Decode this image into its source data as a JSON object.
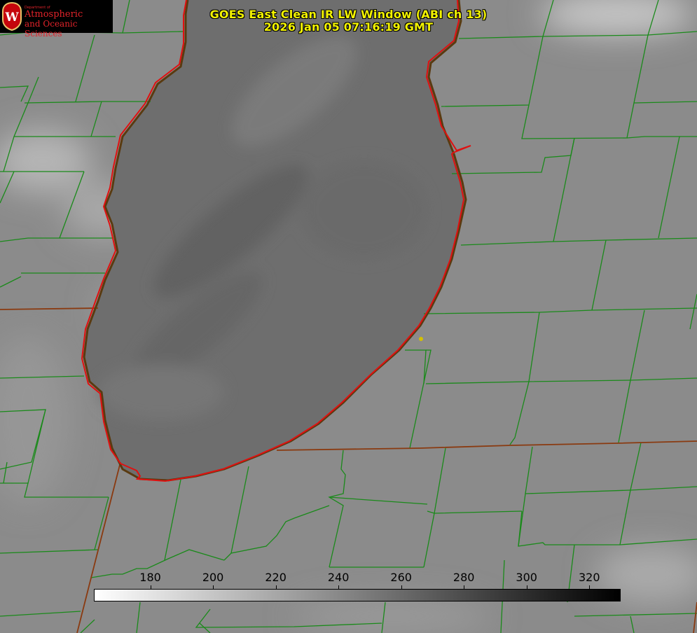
{
  "title": {
    "line1": "GOES East Clean IR LW Window (ABI ch 13)",
    "line2": "2026 Jan 05 07:16:19 GMT"
  },
  "logo": {
    "department_line": "Department of",
    "name_line1": "Atmospheric",
    "name_line2": "and Oceanic Sciences",
    "crest_letter": "W"
  },
  "colorbar": {
    "range_min": 162,
    "range_max": 330,
    "ticks": [
      180,
      200,
      220,
      240,
      260,
      280,
      300,
      320
    ],
    "gradient": "white-to-black"
  },
  "colors": {
    "title_text": "#f2f200",
    "county_lines": "#1a8a1a",
    "state_lines": "#8a3a10",
    "lake_outline": "#e01010",
    "marker": "#d4c000"
  }
}
